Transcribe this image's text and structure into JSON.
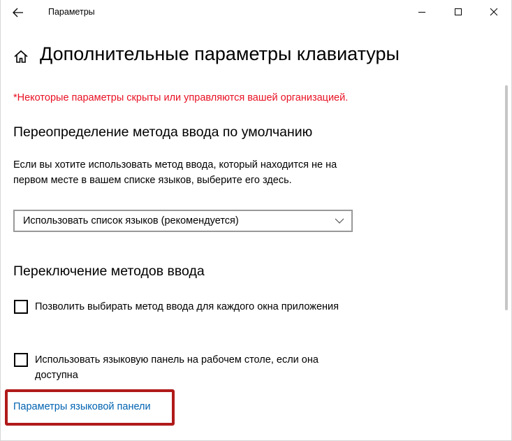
{
  "window": {
    "title": "Параметры"
  },
  "page": {
    "title": "Дополнительные параметры клавиатуры",
    "org_notice": "*Некоторые параметры скрыты или управляются вашей организацией."
  },
  "override_section": {
    "title": "Переопределение метода ввода по умолчанию",
    "description": "Если вы хотите использовать метод ввода, который находится не на первом месте в вашем списке языков, выберите его здесь.",
    "dropdown_value": "Использовать список языков (рекомендуется)"
  },
  "switching_section": {
    "title": "Переключение методов ввода",
    "options": [
      {
        "label": "Позволить выбирать метод ввода для каждого окна приложения",
        "checked": false
      },
      {
        "label": "Использовать языковую панель на рабочем столе, если она доступна",
        "checked": false
      }
    ]
  },
  "links": {
    "language_bar_settings": "Параметры языковой панели"
  },
  "colors": {
    "accent_link": "#0063b1",
    "notice_red": "#e81123",
    "highlight_red": "#b01a1a"
  },
  "icons": [
    "back-arrow-icon",
    "minimize-icon",
    "maximize-icon",
    "close-icon",
    "home-icon",
    "chevron-down-icon"
  ]
}
